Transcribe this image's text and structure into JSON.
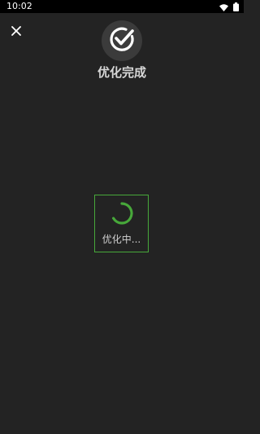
{
  "status_bar": {
    "time": "10:02",
    "icons": [
      "wifi-icon",
      "battery-icon"
    ]
  },
  "close": {
    "icon": "close-icon"
  },
  "header": {
    "badge_icon": "check-circle-icon",
    "title": "优化完成"
  },
  "progress": {
    "label": "优化中...",
    "accent": "#47a83a"
  },
  "colors": {
    "background": "#232323",
    "status_bar": "#000000",
    "accent": "#47a83a"
  }
}
